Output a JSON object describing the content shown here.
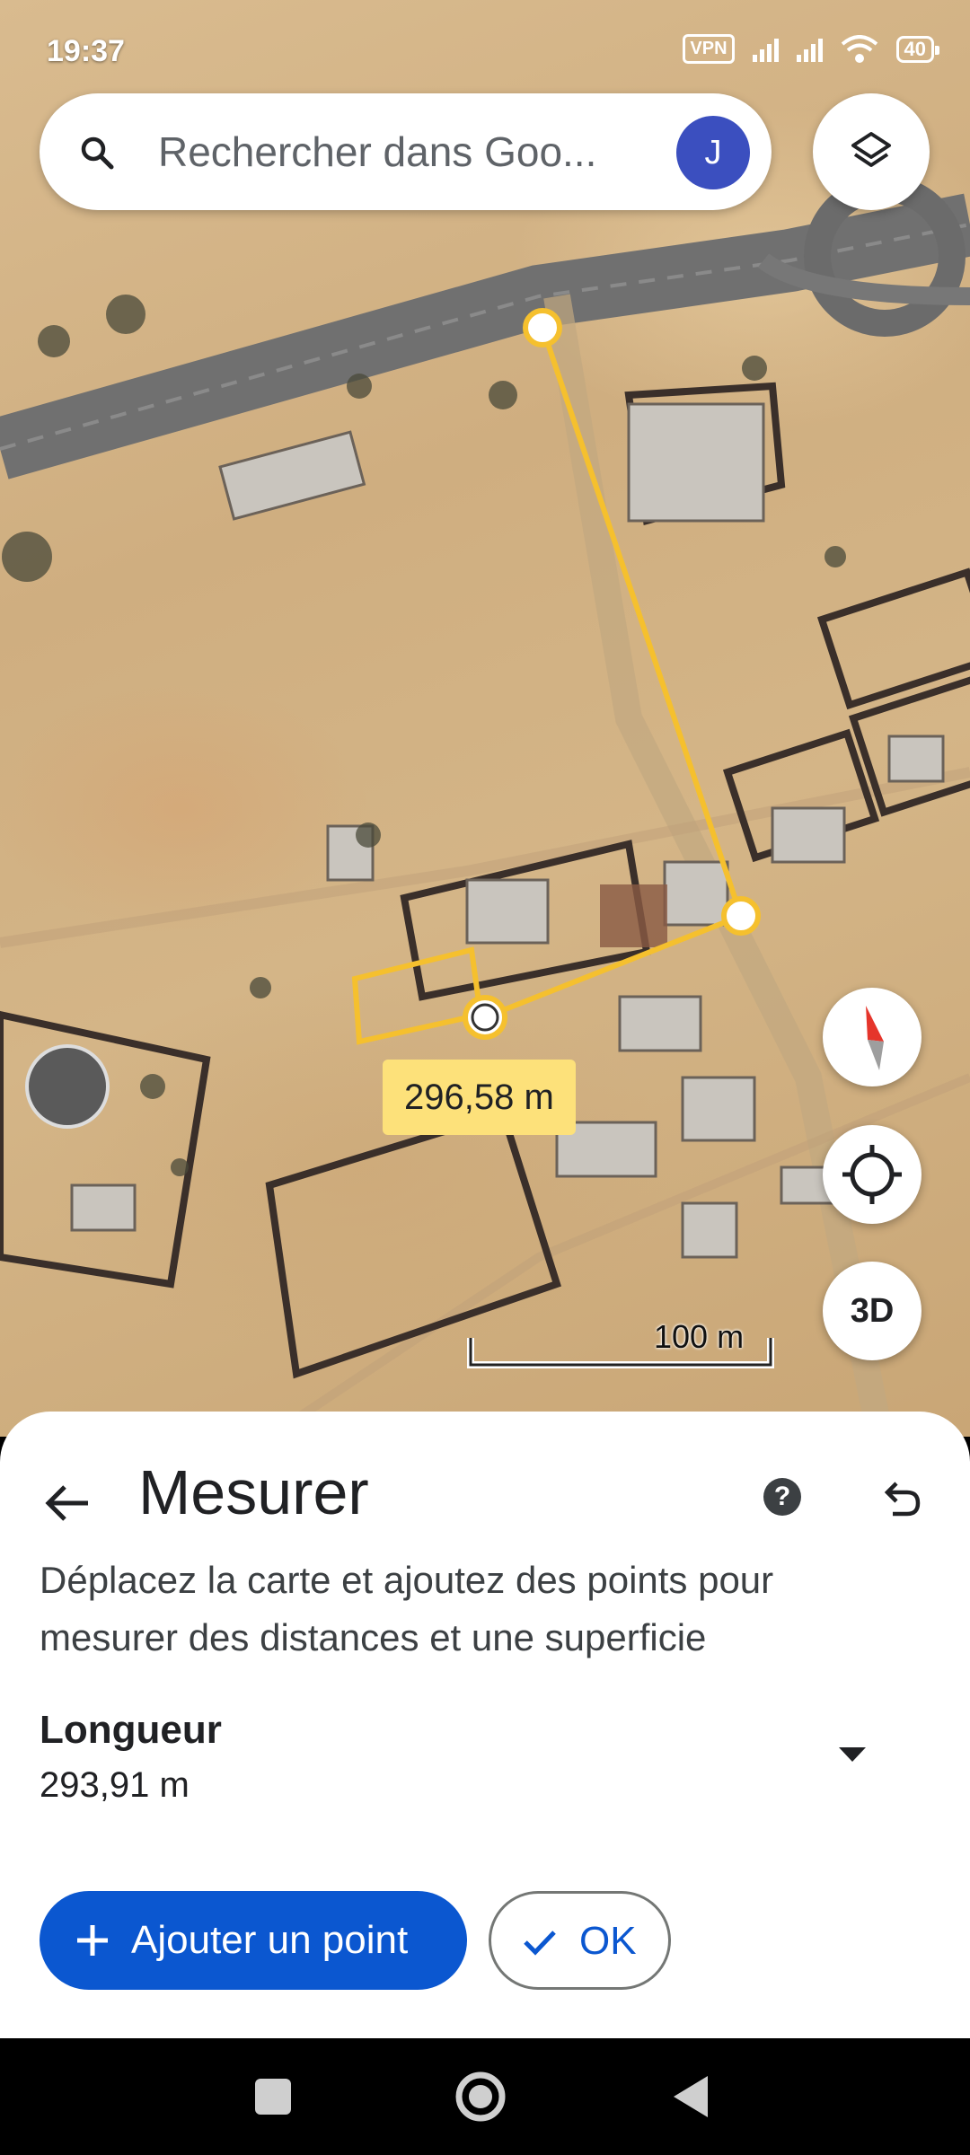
{
  "status_bar": {
    "time": "19:37",
    "vpn": "VPN",
    "battery": "40"
  },
  "search": {
    "placeholder": "Rechercher dans Goo...",
    "avatar_initial": "J"
  },
  "map": {
    "distance_label": "296,58 m",
    "scale_label": "100 m",
    "threed_label": "3D",
    "measure_line_color": "#f5c02e"
  },
  "sheet": {
    "title": "Mesurer",
    "help": "?",
    "instructions": "Déplacez la carte et ajoutez des points pour mesurer des distances et une superficie",
    "length_label": "Longueur",
    "length_value": "293,91 m",
    "add_point_label": "Ajouter un point",
    "ok_label": "OK"
  },
  "colors": {
    "primary": "#0b57d0",
    "avatar": "#3b4fbf",
    "label_bg": "#fde17a"
  }
}
